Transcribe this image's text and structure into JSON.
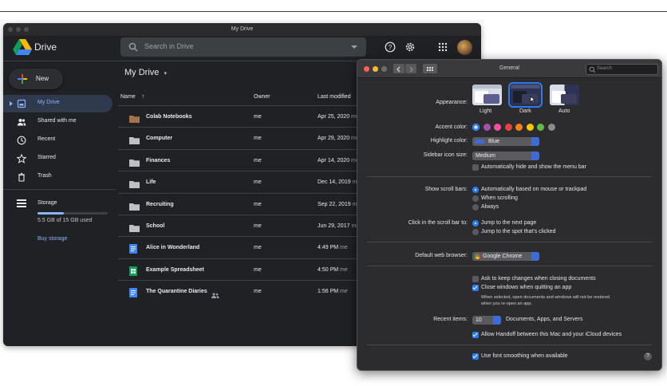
{
  "drive": {
    "window_title": "My Drive",
    "brand": "Drive",
    "search_placeholder": "Search in Drive",
    "new_label": "New",
    "nav": [
      {
        "label": "My Drive"
      },
      {
        "label": "Shared with me"
      },
      {
        "label": "Recent"
      },
      {
        "label": "Starred"
      },
      {
        "label": "Trash"
      }
    ],
    "storage": {
      "label": "Storage",
      "used_text": "5.5 GB of 15 GB used",
      "used_fraction": 0.37,
      "buy_label": "Buy storage"
    },
    "breadcrumb": "My Drive",
    "columns": {
      "name": "Name",
      "owner": "Owner",
      "modified": "Last modified"
    },
    "files": [
      {
        "name": "Colab Notebooks",
        "owner": "me",
        "modified": "Apr 25, 2020",
        "modifier": "me",
        "type": "folder-orange"
      },
      {
        "name": "Computer",
        "owner": "me",
        "modified": "Apr 29, 2020",
        "modifier": "me",
        "type": "folder"
      },
      {
        "name": "Finances",
        "owner": "me",
        "modified": "Apr 14, 2020",
        "modifier": "me",
        "type": "folder"
      },
      {
        "name": "Life",
        "owner": "me",
        "modified": "Dec 14, 2019",
        "modifier": "me",
        "type": "folder"
      },
      {
        "name": "Recruiting",
        "owner": "me",
        "modified": "Sep 22, 2019",
        "modifier": "me",
        "type": "folder"
      },
      {
        "name": "School",
        "owner": "me",
        "modified": "Jun 29, 2017",
        "modifier": "me",
        "type": "folder"
      },
      {
        "name": "Alice in Wonderland",
        "owner": "me",
        "modified": "4:49 PM",
        "modifier": "me",
        "type": "doc"
      },
      {
        "name": "Example Spreadsheet",
        "owner": "me",
        "modified": "4:50 PM",
        "modifier": "me",
        "type": "sheet"
      },
      {
        "name": "The Quarantine Diaries",
        "owner": "me",
        "modified": "1:56 PM",
        "modifier": "me",
        "type": "doc"
      }
    ]
  },
  "prefs": {
    "title": "General",
    "search_placeholder": "Search",
    "appearance_label": "Appearance:",
    "appearance_options": [
      "Light",
      "Dark",
      "Auto"
    ],
    "appearance_selected": "Dark",
    "accent_label": "Accent color:",
    "accent_colors": [
      "#2a7cf7",
      "#a550a7",
      "#f74f9e",
      "#e8423f",
      "#f7821b",
      "#ffc600",
      "#62ba46",
      "#8c8c8c"
    ],
    "highlight_label": "Highlight color:",
    "highlight_value": "Blue",
    "sidebar_label": "Sidebar icon size:",
    "sidebar_value": "Medium",
    "autohide_label": "Automatically hide and show the menu bar",
    "scroll_label": "Show scroll bars:",
    "scroll_options": [
      "Automatically based on mouse or trackpad",
      "When scrolling",
      "Always"
    ],
    "click_label": "Click in the scroll bar to:",
    "click_options": [
      "Jump to the next page",
      "Jump to the spot that's clicked"
    ],
    "browser_label": "Default web browser:",
    "browser_value": "Google Chrome",
    "ask_keep_label": "Ask to keep changes when closing documents",
    "close_windows_label": "Close windows when quitting an app",
    "close_windows_note_1": "When selected, open documents and windows will not be restored",
    "close_windows_note_2": "when you re-open an app.",
    "recent_label": "Recent items:",
    "recent_value": "10",
    "recent_suffix": "Documents, Apps, and Servers",
    "handoff_label": "Allow Handoff between this Mac and your iCloud devices",
    "font_smoothing_label": "Use font smoothing when available",
    "help_glyph": "?"
  }
}
